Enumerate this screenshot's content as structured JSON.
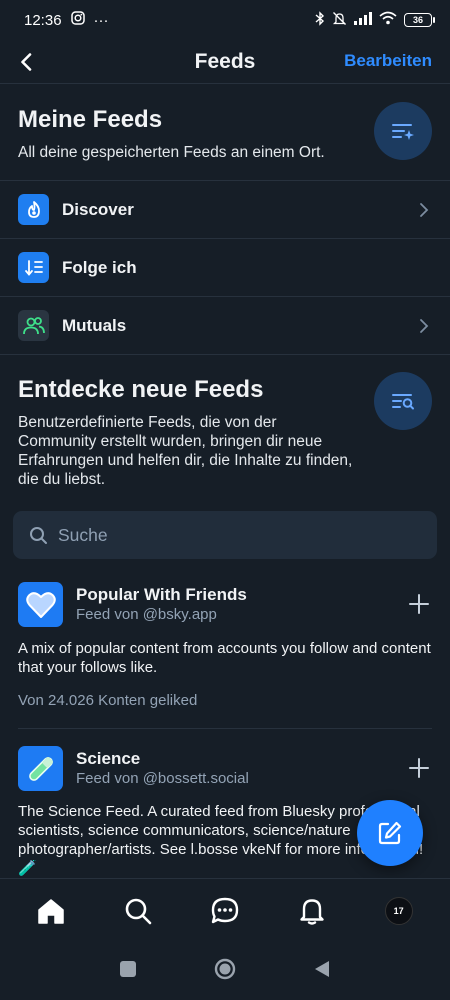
{
  "status": {
    "time": "12:36",
    "more": "···",
    "battery": "36"
  },
  "header": {
    "title": "Feeds",
    "edit_label": "Bearbeiten"
  },
  "my_feeds": {
    "title": "Meine Feeds",
    "description": "All deine gespeicherten Feeds an einem Ort.",
    "items": [
      {
        "label": "Discover",
        "icon": "discover-icon",
        "color": "#1f7ef0"
      },
      {
        "label": "Folge ich",
        "icon": "following-icon",
        "color": "#1f7ef0"
      },
      {
        "label": "Mutuals",
        "icon": "mutuals-icon",
        "color": "#2a3541"
      }
    ]
  },
  "discover": {
    "title": "Entdecke neue Feeds",
    "description": "Benutzerdefinierte Feeds, die von der Community erstellt wurden, bringen dir neue Erfahrungen und helfen dir, die Inhalte zu finden, die du liebst."
  },
  "search": {
    "placeholder": "Suche"
  },
  "cards": [
    {
      "title": "Popular With Friends",
      "subtitle": "Feed von @bsky.app",
      "description": "A mix of popular content from accounts you follow and content that your follows like.",
      "likes": "Von 24.026 Konten geliked",
      "icon": "heart-icon"
    },
    {
      "title": "Science",
      "subtitle": "Feed von @bossett.social",
      "description": "The Science Feed. A curated feed from Bluesky professional scientists,  science communicators, science/nature photographer/artists. See l.bosse vkeNf for more information! 🧪",
      "icon": "test-tube-icon"
    }
  ],
  "tabs": [
    "home",
    "search",
    "chat",
    "notifications",
    "profile"
  ],
  "profile_avatar_text": "17",
  "colors": {
    "accent": "#1f80ff",
    "background": "#161e27",
    "surface": "#212d3b",
    "muted": "#93a3b5"
  }
}
